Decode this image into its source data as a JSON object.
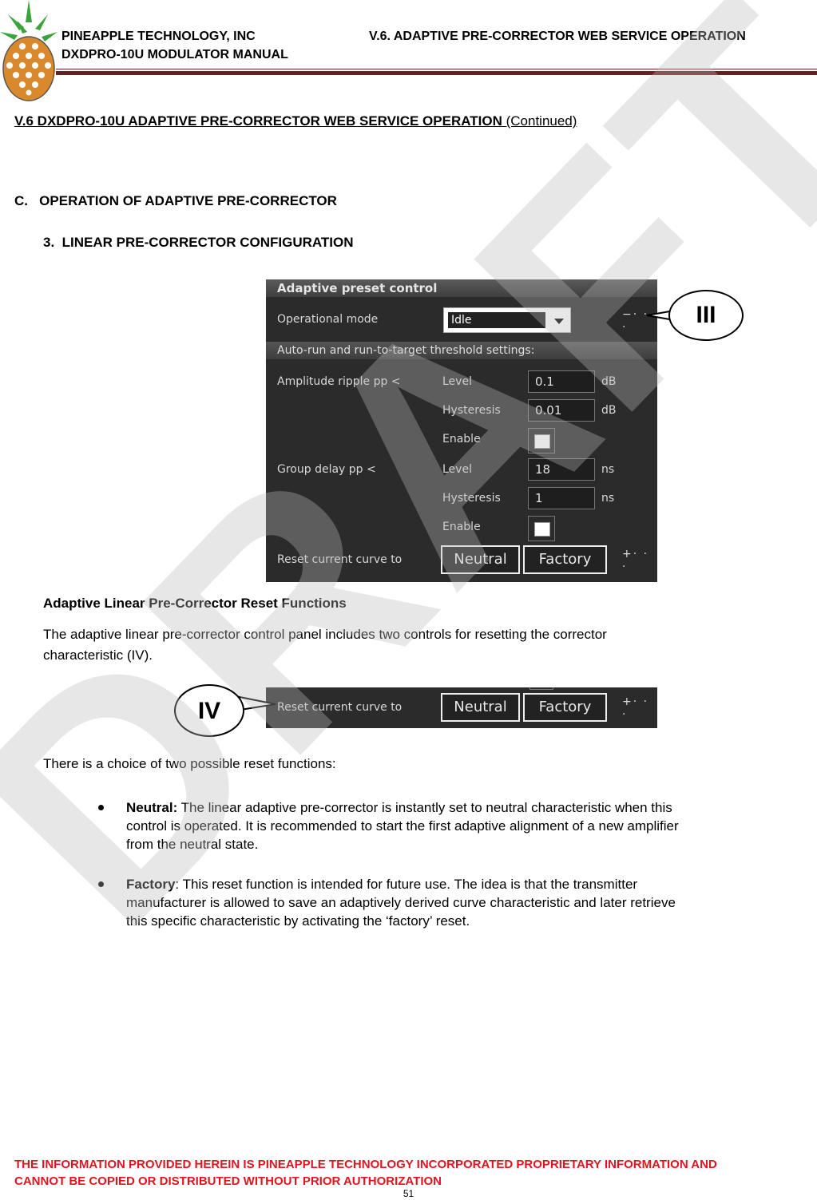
{
  "header": {
    "company": "PINEAPPLE TECHNOLOGY, INC",
    "manual": "DXDPRO-10U MODULATOR MANUAL",
    "section_ref": "V.6. ADAPTIVE PRE-CORRECTOR WEB SERVICE OPERATION",
    "logo": "pineapple-logo"
  },
  "section": {
    "title": "V.6  DXDPRO-10U ADAPTIVE PRE-CORRECTOR WEB SERVICE OPERATION",
    "continued": "(Continued)",
    "subsection": "C.   OPERATION OF ADAPTIVE PRE-CORRECTOR",
    "item": "3.  LINEAR PRE-CORRECTOR CONFIGURATION"
  },
  "panel": {
    "title": "Adaptive preset control",
    "operational_mode_label": "Operational mode",
    "operational_mode_value": "Idle",
    "collapse_dots": "−· · ·",
    "threshold_header": "Auto-run and run-to-target threshold settings:",
    "amplitude": {
      "label": "Amplitude ripple pp <",
      "level_label": "Level",
      "level_value": "0.1",
      "level_unit": "dB",
      "hysteresis_label": "Hysteresis",
      "hysteresis_value": "0.01",
      "hysteresis_unit": "dB",
      "enable_label": "Enable"
    },
    "group_delay": {
      "label": "Group delay pp <",
      "level_label": "Level",
      "level_value": "18",
      "level_unit": "ns",
      "hysteresis_label": "Hysteresis",
      "hysteresis_value": "1",
      "hysteresis_unit": "ns",
      "enable_label": "Enable"
    },
    "reset_label": "Reset current curve to",
    "neutral_button": "Neutral",
    "factory_button": "Factory",
    "expand_dots": "+· · ·"
  },
  "callouts": {
    "iii": "III",
    "iv": "IV"
  },
  "content": {
    "reset_heading": "Adaptive Linear Pre-Corrector Reset Functions",
    "reset_intro_line1": "The adaptive linear pre-corrector control panel includes two controls for resetting the corrector",
    "reset_intro_line2": "characteristic (IV).",
    "choice_text": "There is a choice of two possible reset functions:",
    "bullets": [
      {
        "term": "Neutral:",
        "line1": " The linear adaptive pre-corrector is instantly set to neutral characteristic when this",
        "line2": "control is operated. It is recommended to start the first adaptive alignment of a new amplifier",
        "line3": "from the neutral state."
      },
      {
        "term": "Factory",
        "colon": ":",
        "line1": " This reset function is intended for future use. The idea is that the transmitter",
        "line2": "manufacturer is allowed to save an adaptively derived curve characteristic and later retrieve",
        "line3": "this specific characteristic by activating the ‘factory’ reset."
      }
    ]
  },
  "footer": {
    "line1": "THE INFORMATION PROVIDED HEREIN IS PINEAPPLE TECHNOLOGY INCORPORATED PROPRIETARY INFORMATION AND",
    "line2": "CANNOT BE COPIED OR DISTRIBUTED WITHOUT PRIOR AUTHORIZATION",
    "page_number": "51"
  },
  "watermark": "DRAFT"
}
